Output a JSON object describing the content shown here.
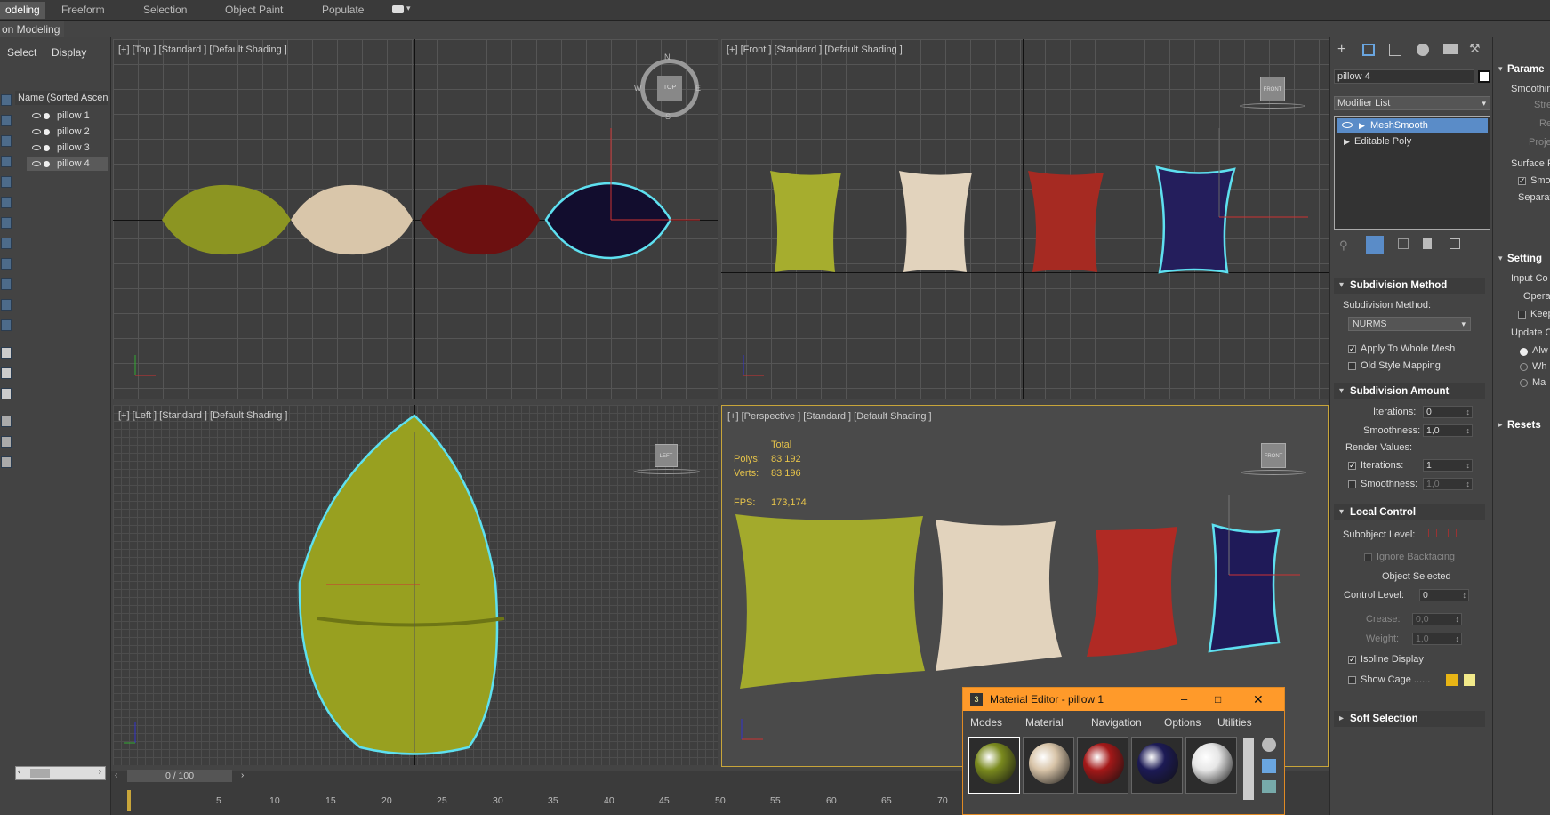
{
  "ribbon": {
    "tabs": [
      "odeling",
      "Freeform",
      "Selection",
      "Object Paint",
      "Populate"
    ],
    "sub_label": "on Modeling"
  },
  "explorer": {
    "menu": [
      "Select",
      "Display"
    ],
    "header": "Name (Sorted Ascen",
    "items": [
      "pillow 1",
      "pillow 2",
      "pillow 3",
      "pillow 4"
    ]
  },
  "viewports": {
    "top": "[+] [Top ] [Standard ] [Default Shading ]",
    "front": "[+] [Front ] [Standard ] [Default Shading ]",
    "left": "[+] [Left ] [Standard ] [Default Shading ]",
    "perspective": "[+] [Perspective ] [Standard ] [Default Shading ]",
    "compass": {
      "n": "N",
      "s": "S",
      "e": "E",
      "w": "W",
      "center": "TOP"
    },
    "viewcube_front": "FRONT",
    "viewcube_left": "LEFT",
    "stats": {
      "total_label": "Total",
      "polys_label": "Polys:",
      "polys_value": "83 192",
      "verts_label": "Verts:",
      "verts_value": "83 196",
      "fps_label": "FPS:",
      "fps_value": "173,174"
    }
  },
  "modifier_panel": {
    "object_name": "pillow 4",
    "modifier_list": "Modifier List",
    "stack": [
      "MeshSmooth",
      "Editable Poly"
    ],
    "subdivision_method": {
      "title": "Subdivision Method",
      "label": "Subdivision Method:",
      "value": "NURMS",
      "apply_whole_mesh": "Apply To Whole Mesh",
      "old_style_mapping": "Old Style Mapping"
    },
    "subdivision_amount": {
      "title": "Subdivision Amount",
      "iterations_label": "Iterations:",
      "iterations_value": "0",
      "smoothness_label": "Smoothness:",
      "smoothness_value": "1,0",
      "render_values": "Render Values:",
      "r_iterations_label": "Iterations:",
      "r_iterations_value": "1",
      "r_smoothness_label": "Smoothness:",
      "r_smoothness_value": "1,0"
    },
    "local_control": {
      "title": "Local Control",
      "subobject_label": "Subobject Level:",
      "ignore_backfacing": "Ignore Backfacing",
      "object_selected": "Object Selected",
      "control_level_label": "Control Level:",
      "control_level_value": "0",
      "crease_label": "Crease:",
      "crease_value": "0,0",
      "weight_label": "Weight:",
      "weight_value": "1,0",
      "isoline_display": "Isoline Display",
      "show_cage": "Show Cage ......"
    },
    "soft_selection": "Soft Selection"
  },
  "right_panel": {
    "params": "Parame",
    "smoothing": "Smoothin",
    "strength": "Streng",
    "rel": "Rel",
    "proje": "Proje",
    "surface": "Surface P",
    "smoo": "Smoo",
    "separate": "Separat",
    "settings": "Setting",
    "input_co": "Input Co",
    "opera": "Opera",
    "keep": "Keep",
    "update": "Update C",
    "alw": "Alw",
    "wh": "Wh",
    "ma": "Ma",
    "resets": "Resets"
  },
  "timeline": {
    "frame": "0 / 100",
    "ticks": [
      "5",
      "10",
      "15",
      "20",
      "25",
      "30",
      "35",
      "40",
      "45",
      "50",
      "55",
      "60",
      "65",
      "70"
    ]
  },
  "material_editor": {
    "title": "Material Editor - pillow 1",
    "menu": [
      "Modes",
      "Material",
      "Navigation",
      "Options",
      "Utilities"
    ],
    "slot_colors": [
      "#7a8a1e",
      "#d8c4a8",
      "#a41818",
      "#1c1a55",
      "#e6e6e6"
    ]
  },
  "colors": {
    "selection_outline": "#5ee0f0",
    "pillow_green": "#9aa324",
    "pillow_cream": "#e2d3bd",
    "pillow_red": "#9b2020",
    "pillow_navy": "#221d58",
    "accent_orange": "#ff9a2a",
    "stats_yellow": "#e6c34a"
  }
}
